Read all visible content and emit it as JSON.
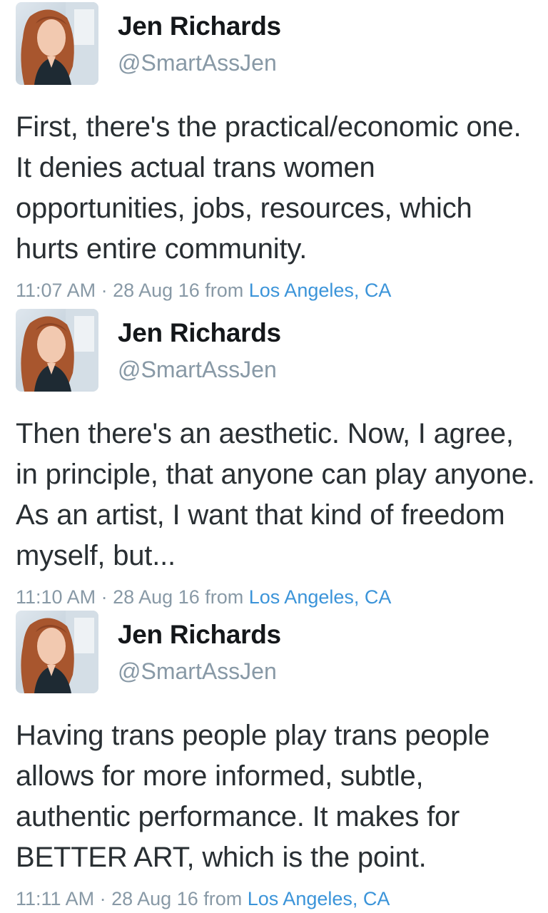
{
  "tweets": [
    {
      "author_name": "Jen Richards",
      "handle": "@SmartAssJen",
      "text": "First, there's the practical/economic one. It denies actual trans women opportunities, jobs, resources, which hurts entire community.",
      "time": "11:07 AM",
      "date": "28 Aug 16",
      "from_label": "from",
      "location": "Los Angeles, CA"
    },
    {
      "author_name": "Jen Richards",
      "handle": "@SmartAssJen",
      "text": "Then there's an aesthetic. Now, I agree, in principle, that anyone can play anyone. As an artist, I want that kind of freedom myself, but...",
      "time": "11:10 AM",
      "date": "28 Aug 16",
      "from_label": "from",
      "location": "Los Angeles, CA"
    },
    {
      "author_name": "Jen Richards",
      "handle": "@SmartAssJen",
      "text": "Having trans people play trans people allows for more informed, subtle, authentic performance. It makes for BETTER ART, which is the point.",
      "time": "11:11 AM",
      "date": "28 Aug 16",
      "from_label": "from",
      "location": "Los Angeles, CA"
    }
  ],
  "separator": "·",
  "colors": {
    "name": "#14171a",
    "handle": "#8899a6",
    "text": "#292f33",
    "meta": "#8899a6",
    "link": "#3b94d9"
  }
}
